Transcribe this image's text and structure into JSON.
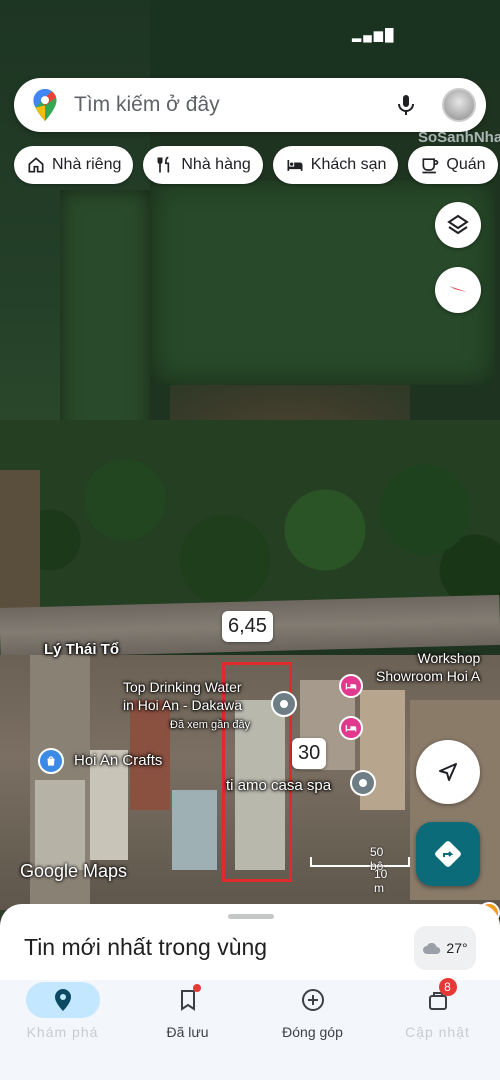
{
  "status_bar": {
    "text": "▂▄▆█"
  },
  "search": {
    "placeholder": "Tìm kiếm ở đây",
    "watermark": "SoSanhNha"
  },
  "chips": [
    {
      "label": "Nhà riêng",
      "icon": "home-icon"
    },
    {
      "label": "Nhà hàng",
      "icon": "restaurant-icon"
    },
    {
      "label": "Khách sạn",
      "icon": "hotel-icon"
    },
    {
      "label": "Quán",
      "icon": "cafe-icon"
    }
  ],
  "map": {
    "measurement_top": "6,45",
    "measurement_side": "30",
    "street_label": "Lý Thái Tổ",
    "poi_water": "Top Drinking Water\nin Hoi An - Dakawa",
    "poi_water_sub": "Đã xem gần đây",
    "poi_crafts": "Hoi An Crafts",
    "poi_spa": "ti amo casa spa",
    "poi_workshop": "Workshop\nShowroom Hoi A",
    "attribution": "Google Maps",
    "scale_imperial": "50 bộ",
    "scale_metric": "10 m"
  },
  "sheet": {
    "title": "Tin mới nhất trong vùng",
    "temperature": "27°"
  },
  "nav": [
    {
      "label": "Khám phá",
      "icon": "explore-pin-icon",
      "active": true
    },
    {
      "label": "Đã lưu",
      "icon": "bookmark-icon"
    },
    {
      "label": "Đóng góp",
      "icon": "add-circle-icon"
    },
    {
      "label": "Cập nhật",
      "icon": "updates-icon",
      "badge": "8"
    }
  ],
  "colors": {
    "accent": "#0c6b78",
    "parcel": "#e12a2a",
    "nav_active": "#c3e7ff"
  }
}
